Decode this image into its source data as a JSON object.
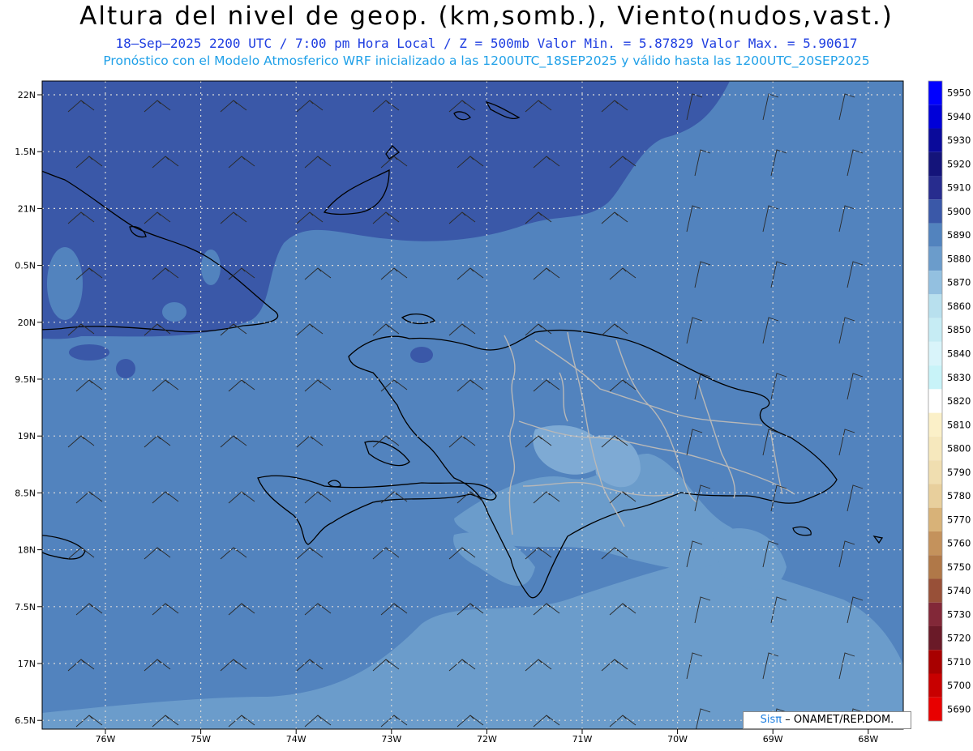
{
  "header": {
    "title": "Altura del nivel de geop. (km,somb.), Viento(nudos,vast.)",
    "subtitle1": "18–Sep–2025  2200 UTC / 7:00 pm Hora Local / Z = 500mb    Valor Min. = 5.87829  Valor Max. = 5.90617",
    "subtitle2": "Pronóstico con el Modelo Atmosferico WRF inicializado a las 1200UTC_18SEP2025 y válido hasta las  1200UTC_20SEP2025"
  },
  "map": {
    "lat_labels": [
      "22N",
      "1.5N",
      "21N",
      "0.5N",
      "20N",
      "9.5N",
      "19N",
      "8.5N",
      "18N",
      "7.5N",
      "17N",
      "6.5N"
    ],
    "lon_labels": [
      "76W",
      "75W",
      "74W",
      "73W",
      "72W",
      "71W",
      "70W",
      "69W",
      "68W"
    ],
    "colors": {
      "dark_band": "#3a58a8",
      "mid": "#5283be",
      "light": "#6b9ccb",
      "lighter": "#7eaad4",
      "grid": "#d8d8d8",
      "coast": "#000000",
      "border": "#b8b8b8"
    }
  },
  "colorbar": {
    "levels": [
      "5950",
      "5940",
      "5930",
      "5920",
      "5910",
      "5900",
      "5890",
      "5880",
      "5870",
      "5860",
      "5850",
      "5840",
      "5830",
      "5820",
      "5810",
      "5800",
      "5790",
      "5780",
      "5770",
      "5760",
      "5750",
      "5740",
      "5730",
      "5720",
      "5710",
      "5700",
      "5690"
    ],
    "colors": [
      "#0000ff",
      "#0000d8",
      "#0a0a9a",
      "#14147a",
      "#272c8e",
      "#3a58a8",
      "#5283be",
      "#6b9ccb",
      "#93c0e0",
      "#b8e0ee",
      "#c6ecf4",
      "#d9f4fa",
      "#c8f3f8",
      "#ffffff",
      "#fbf0c8",
      "#f6e8bd",
      "#f0deb0",
      "#e8cf9c",
      "#d8b278",
      "#c4925c",
      "#b07848",
      "#985038",
      "#822838",
      "#6a1a28",
      "#a80000",
      "#c80000",
      "#e80000"
    ]
  },
  "credit": {
    "sis": "Sisπ",
    "text": "– ONAMET/REP.DOM."
  }
}
